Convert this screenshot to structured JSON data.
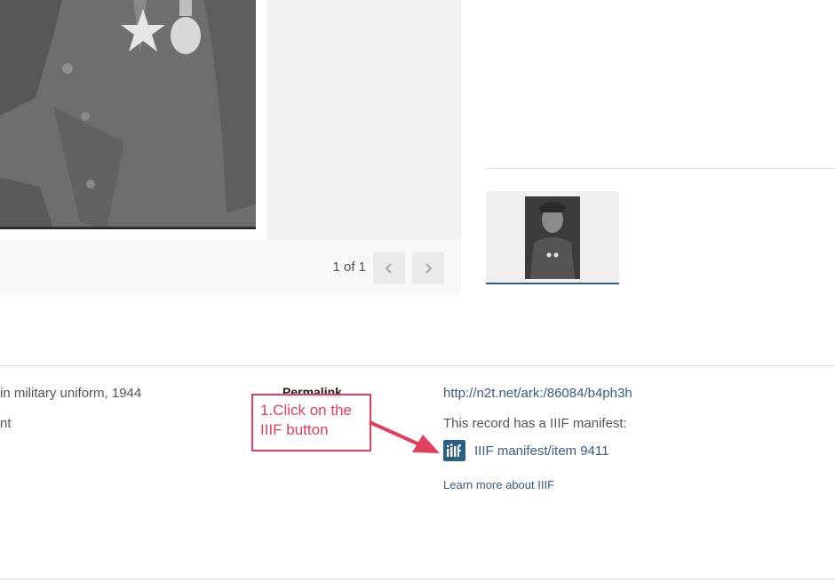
{
  "viewer": {
    "page_count": "1 of 1",
    "prev_icon": "chevron-left-icon",
    "next_icon": "chevron-right-icon"
  },
  "metadata": {
    "description_fragment": "in military uniform, 1944",
    "second_fragment": "nt",
    "permalink_label": "Permalink",
    "permalink_url": "http://n2t.net/ark:/86084/b4ph3h",
    "iiif_note": "This record has a IIIF manifest:",
    "iiif_icon": "iiif-logo-icon",
    "iiif_link": "IIIF manifest/item 9411",
    "learn_more": "Learn more about IIIF"
  },
  "annotation": {
    "line1": "1.Click on the",
    "line2": "IIIF button",
    "color": "#e0405e"
  },
  "colors": {
    "link": "#3d5a80",
    "iiif_brand": "#2c5f86"
  }
}
